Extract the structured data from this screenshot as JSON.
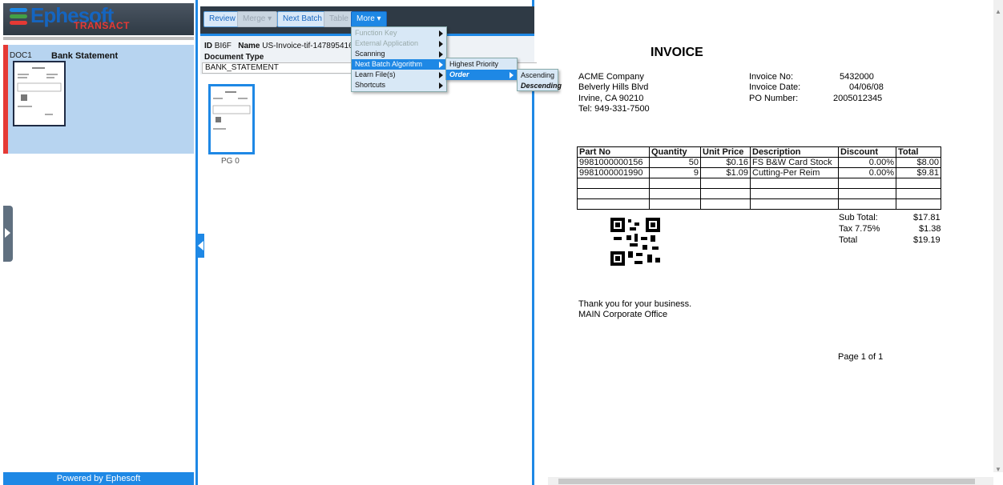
{
  "app": {
    "logo_name": "Ephesoft",
    "logo_sub": "TRANSACT",
    "powered_by": "Powered by Ephesoft"
  },
  "left_panel": {
    "doc_id": "DOC1",
    "doc_type": "Bank Statement"
  },
  "toolbar": {
    "review": "Review",
    "merge": "Merge ▾",
    "next_batch": "Next Batch",
    "table": "Table",
    "more": "More ▾"
  },
  "doc_header": {
    "id_label": "ID",
    "id_value": "BI6F",
    "name_label": "Name",
    "name_value": "US-Invoice-tif-14789541652",
    "doctype_label": "Document Type",
    "doctype_value": "BANK_STATEMENT",
    "page_label": "PG 0"
  },
  "more_menu": {
    "items": [
      {
        "label": "Function Key",
        "disabled": true
      },
      {
        "label": "External Application",
        "disabled": true
      },
      {
        "label": "Scanning",
        "disabled": false
      },
      {
        "label": "Next Batch Algorithm",
        "disabled": false
      },
      {
        "label": "Learn File(s)",
        "disabled": false
      },
      {
        "label": "Shortcuts",
        "disabled": false
      }
    ]
  },
  "submenu_algorithm": {
    "items": [
      "Highest Priority",
      "Order"
    ]
  },
  "submenu_order": {
    "items": [
      "Ascending",
      "Descending"
    ]
  },
  "invoice": {
    "title": "INVOICE",
    "company": [
      "ACME Company",
      "Belverly Hills Blvd",
      "Irvine, CA 90210",
      "Tel: 949-331-7500"
    ],
    "meta_labels": [
      "Invoice No:",
      "Invoice Date:",
      "PO Number:"
    ],
    "meta_values": [
      "5432000",
      "04/06/08",
      "2005012345"
    ],
    "columns": [
      "Part No",
      "Quantity",
      "Unit Price",
      "Description",
      "Discount",
      "Total"
    ],
    "rows": [
      [
        "9981000000156",
        "50",
        "$0.16",
        "FS B&W Card Stock",
        "0.00%",
        "$8.00"
      ],
      [
        "9981000001990",
        "9",
        "$1.09",
        "Cutting-Per Reim",
        "0.00%",
        "$9.81"
      ]
    ],
    "summary_labels": [
      "Sub Total:",
      "Tax 7.75%",
      "Total"
    ],
    "summary_values": [
      "$17.81",
      "$1.38",
      "$19.19"
    ],
    "thanks": "Thank you for your business.",
    "office": "MAIN Corporate Office",
    "page": "Page 1 of 1"
  },
  "colors": {
    "accent": "#1e88e5",
    "selected_doc": "#b7d4f0",
    "error_marker": "#e53935",
    "toolbar_bg": "#2f3a45"
  }
}
